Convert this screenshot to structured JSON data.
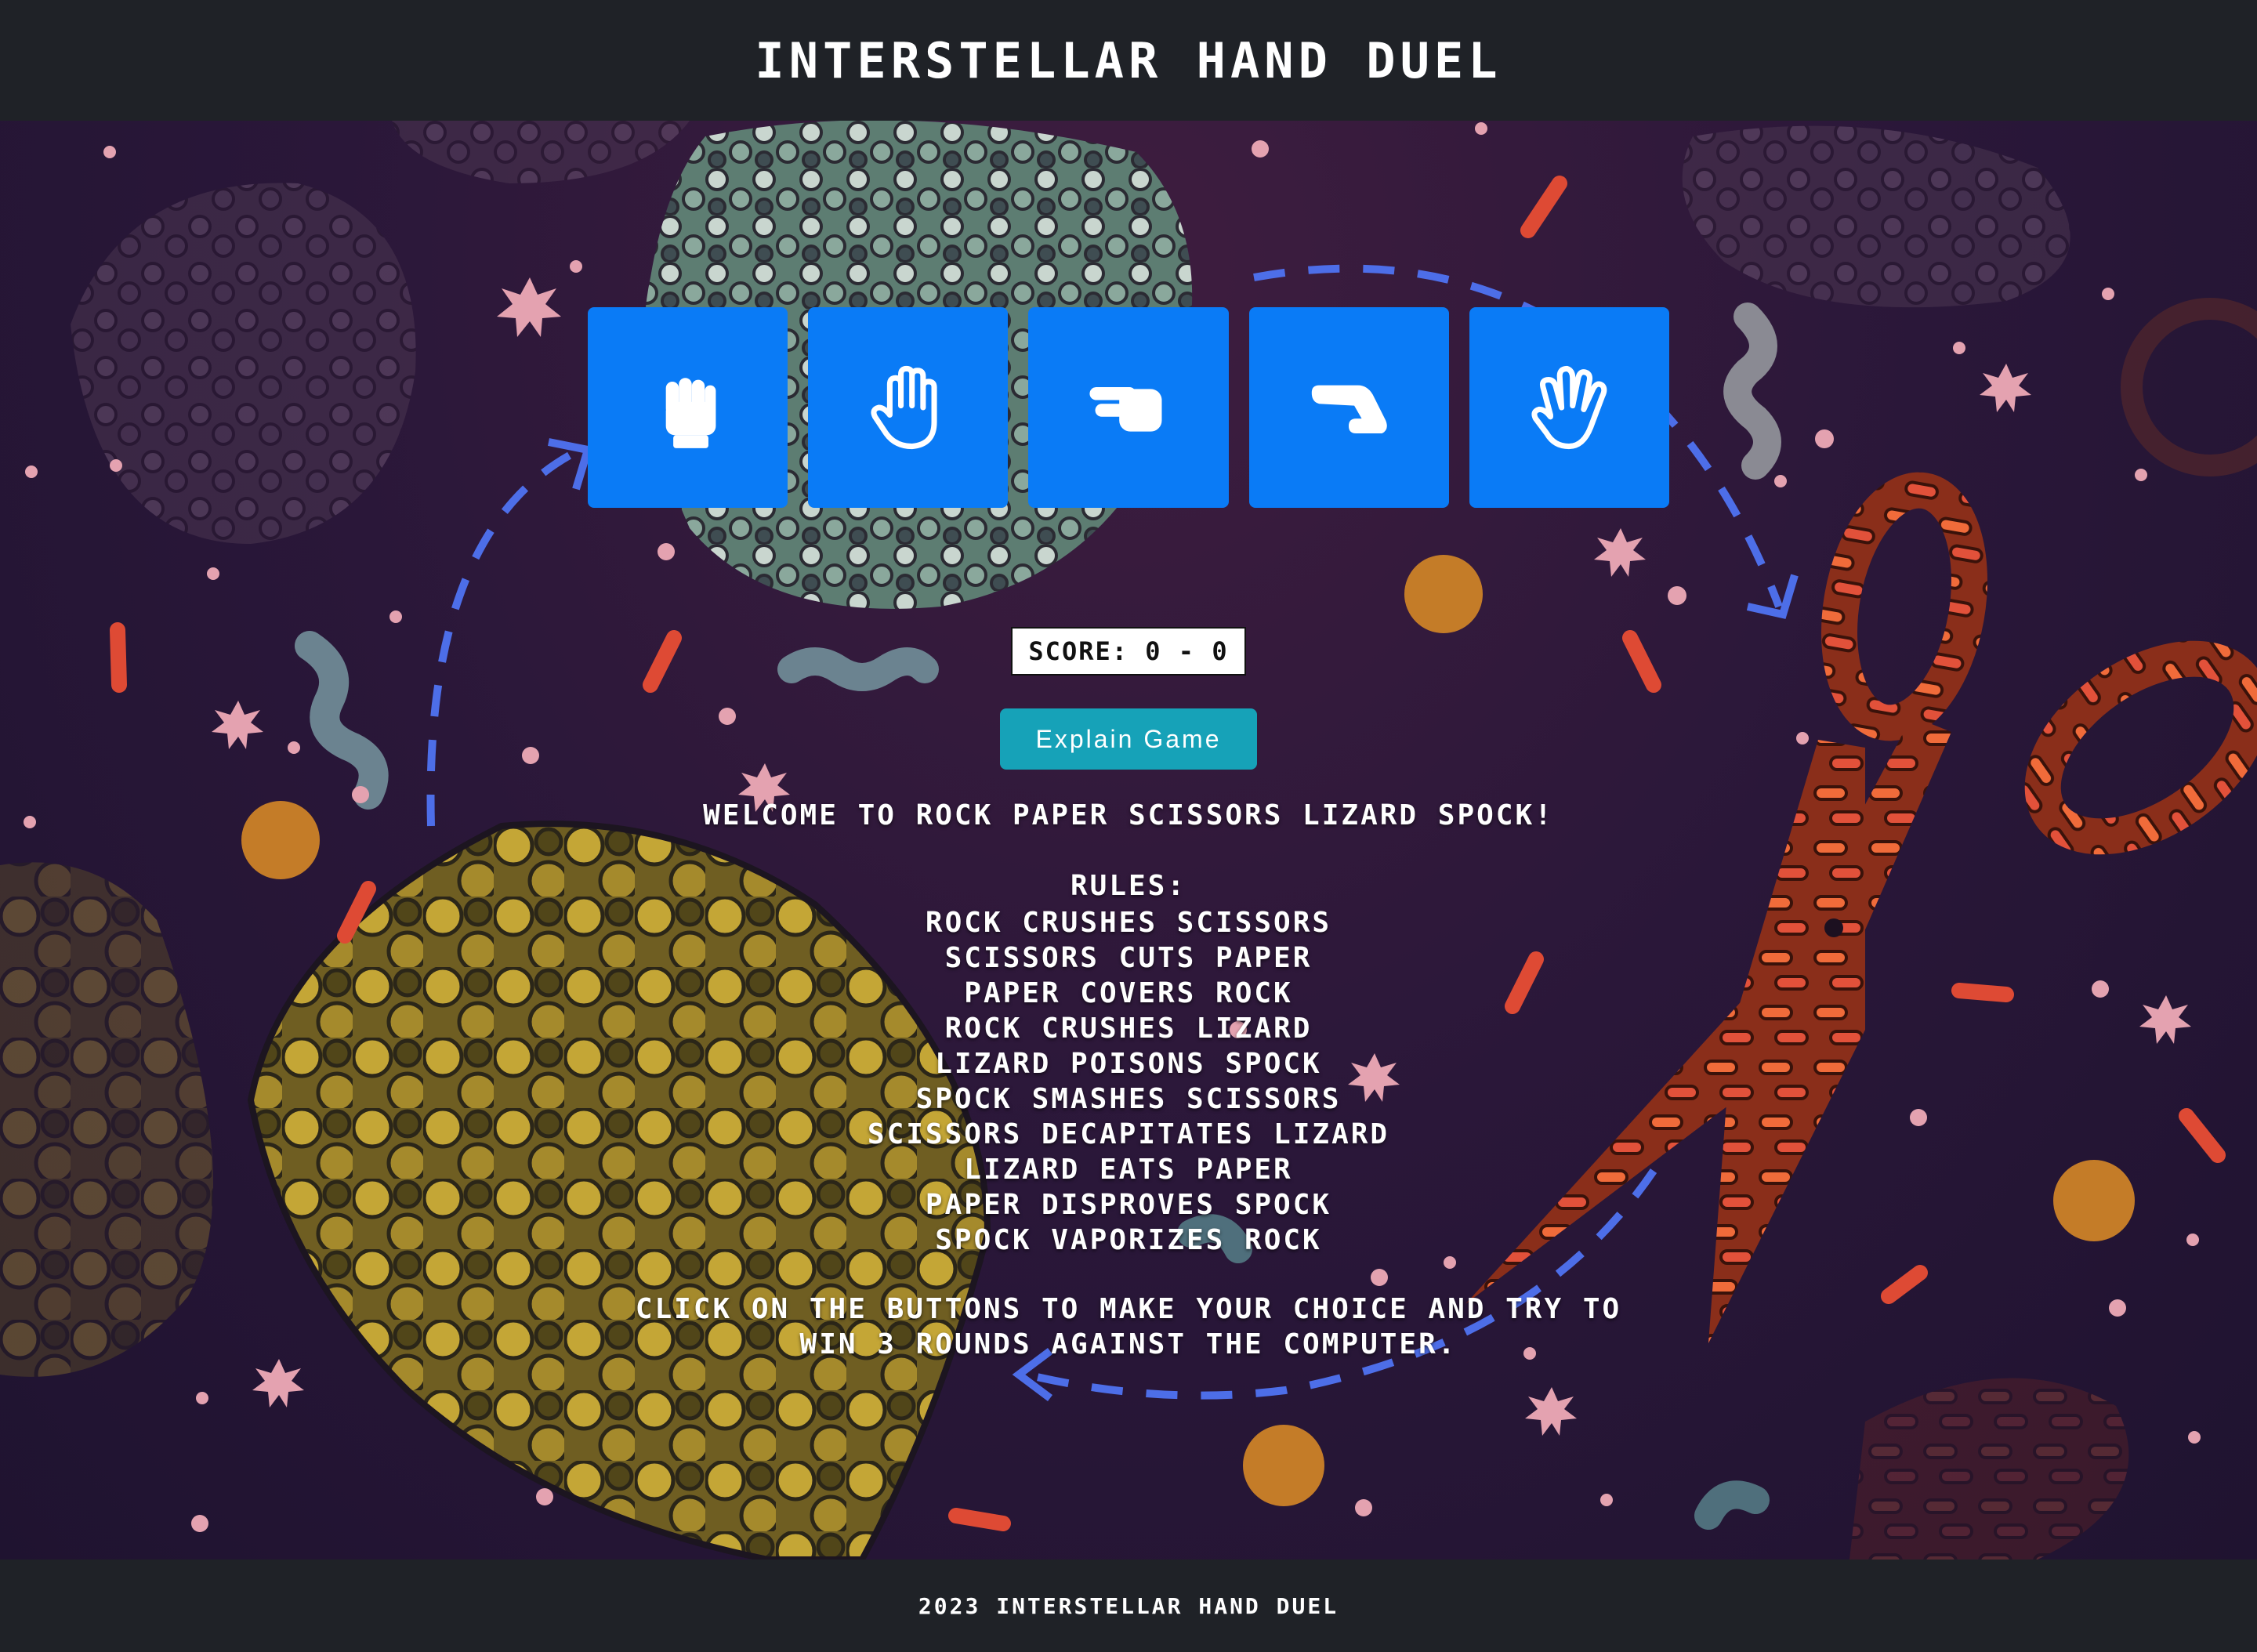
{
  "header": {
    "title": "INTERSTELLAR HAND DUEL"
  },
  "choices": [
    {
      "name": "rock",
      "icon": "hand-rock-icon"
    },
    {
      "name": "paper",
      "icon": "hand-paper-icon"
    },
    {
      "name": "scissors",
      "icon": "hand-scissors-icon"
    },
    {
      "name": "lizard",
      "icon": "hand-lizard-icon"
    },
    {
      "name": "spock",
      "icon": "hand-spock-icon"
    }
  ],
  "score": {
    "label": "SCORE: 0 - 0"
  },
  "explain_button": {
    "label": "Explain Game"
  },
  "welcome": "WELCOME TO ROCK PAPER SCISSORS LIZARD SPOCK!",
  "rules": {
    "title": "RULES:",
    "items": [
      "ROCK CRUSHES SCISSORS",
      "SCISSORS CUTS PAPER",
      "PAPER COVERS ROCK",
      "ROCK CRUSHES LIZARD",
      "LIZARD POISONS SPOCK",
      "SPOCK SMASHES SCISSORS",
      "SCISSORS DECAPITATES LIZARD",
      "LIZARD EATS PAPER",
      "PAPER DISPROVES SPOCK",
      "SPOCK VAPORIZES ROCK"
    ]
  },
  "instructions": "CLICK ON THE BUTTONS TO MAKE YOUR CHOICE AND TRY TO WIN 3 ROUNDS AGAINST THE COMPUTER.",
  "footer": {
    "text": "2023 INTERSTELLAR HAND DUEL"
  },
  "colors": {
    "bar": "#1f2227",
    "choice_button": "#0a7bf6",
    "explain_button": "#16a2b8",
    "background": "#2a1838"
  }
}
